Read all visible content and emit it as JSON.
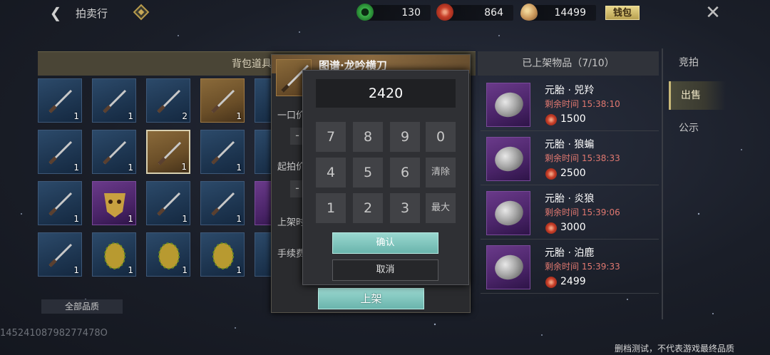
{
  "topbar": {
    "title": "拍卖行",
    "wallet_label": "钱包",
    "currencies": [
      {
        "icon": "jade-coin-icon",
        "value": "130"
      },
      {
        "icon": "copper-coin-icon",
        "value": "864"
      },
      {
        "icon": "gold-ingot-icon",
        "value": "14499"
      }
    ]
  },
  "left_panel": {
    "header": "背包道具物",
    "quality_filter": "全部品质",
    "items": [
      {
        "icon": "painting-scroll-icon",
        "count": "1",
        "rarity": "blue"
      },
      {
        "icon": "carpet-icon",
        "count": "1",
        "rarity": "blue"
      },
      {
        "icon": "table-icon",
        "count": "2",
        "rarity": "blue"
      },
      {
        "icon": "screen-icon",
        "count": "1",
        "rarity": "gold"
      },
      {
        "icon": "axe-icon",
        "count": "1",
        "rarity": "blue"
      },
      {
        "icon": "spear-icon",
        "count": "1",
        "rarity": "blue"
      },
      {
        "icon": "dao-blade-icon",
        "count": "1",
        "rarity": "gold"
      },
      {
        "icon": "battle-axe-icon",
        "count": "1",
        "rarity": "blue"
      },
      {
        "icon": "trident-icon",
        "count": "1",
        "rarity": "blue"
      },
      {
        "icon": "mask-icon",
        "count": "1",
        "rarity": "purple"
      },
      {
        "icon": "curved-sword-icon",
        "count": "1",
        "rarity": "blue"
      },
      {
        "icon": "armor-icon",
        "count": "1",
        "rarity": "blue"
      },
      {
        "icon": "crab-armor-icon",
        "count": "1",
        "rarity": "blue"
      },
      {
        "icon": "egg-icon",
        "count": "1",
        "rarity": "blue"
      },
      {
        "icon": "egg-icon",
        "count": "1",
        "rarity": "blue"
      },
      {
        "icon": "egg-icon",
        "count": "1",
        "rarity": "blue"
      }
    ],
    "partial_items": [
      "blue",
      "blue",
      "purple",
      "blue"
    ]
  },
  "listing_dialog": {
    "title": "图谱·龙吟横刀",
    "buyout_label": "一口价",
    "start_label": "起拍价",
    "duration_label": "上架时",
    "fee_label": "手续费",
    "list_button": "上架"
  },
  "keypad": {
    "display": "2420",
    "keys": [
      "7",
      "8",
      "9",
      "0",
      "4",
      "5",
      "6",
      "清除",
      "1",
      "2",
      "3",
      "最大"
    ],
    "confirm": "确认",
    "cancel": "取消"
  },
  "right_panel": {
    "header": "已上架物品（7/10）",
    "listings": [
      {
        "name": "元胎 · 兕羚",
        "time": "剩余时间 15:38:10",
        "price": "1500"
      },
      {
        "name": "元胎 · 狼蝙",
        "time": "剩余时间 15:38:33",
        "price": "2500"
      },
      {
        "name": "元胎 · 炎狼",
        "time": "剩余时间 15:39:06",
        "price": "3000"
      },
      {
        "name": "元胎 · 泊鹿",
        "time": "剩余时间 15:39:33",
        "price": "2499"
      }
    ]
  },
  "side_tabs": [
    {
      "label": "竞拍",
      "active": false
    },
    {
      "label": "出售",
      "active": true
    },
    {
      "label": "公示",
      "active": false
    }
  ],
  "footer": {
    "user_id": "14524108798277478O",
    "disclaimer": "删档测试，不代表游戏最终品质"
  }
}
